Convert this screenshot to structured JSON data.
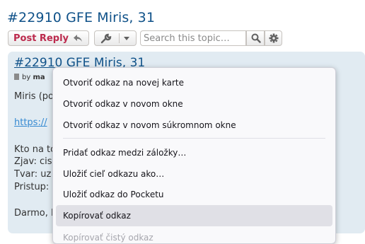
{
  "topic": {
    "title": "#22910 GFE Miris, 31"
  },
  "toolbar": {
    "post_reply_label": "Post Reply",
    "search_placeholder": "Search this topic…"
  },
  "post": {
    "title": "#22910 GFE Miris, 31",
    "meta_prefix": "by",
    "meta_author_partial": "ma",
    "lines": {
      "intro": "Miris (po",
      "link": "https://",
      "who": "Kto na to",
      "look": "Zjav: cis",
      "shape": "Tvar: uz",
      "access": "Pristup: s",
      "sign": "Darmo, E"
    }
  },
  "context_menu": {
    "items": [
      "Otvoriť odkaz na novej karte",
      "Otvoriť odkaz v novom okne",
      "Otvoriť odkaz v novom súkromnom okne",
      "Pridať odkaz medzi záložky…",
      "Uložiť cieľ odkazu ako…",
      "Uložiť odkaz do Pocketu",
      "Kopírovať odkaz",
      "Kopírovať čistý odkaz"
    ],
    "hovered_index": 6,
    "disabled_index": 7
  },
  "icons": {
    "reply": "reply-arrow-icon",
    "tools": "wrench-icon",
    "dropdown": "chevron-down-icon",
    "search": "search-icon",
    "advanced": "gear-icon",
    "post": "document-icon"
  },
  "colors": {
    "link": "#105289",
    "post_reply": "#bc2a4d",
    "panel": "#e1ebf2",
    "menu_bg": "#f9f9fb",
    "menu_hover": "#e0e0e6"
  }
}
